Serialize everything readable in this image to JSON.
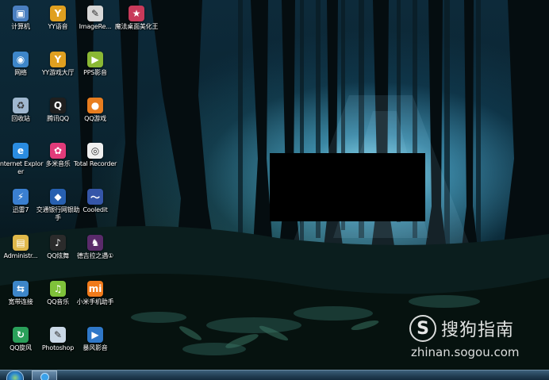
{
  "desktop": {
    "icons": [
      {
        "label": "计算机",
        "icon": "computer-icon",
        "color": "#4a7fc1",
        "glyph": "▣"
      },
      {
        "label": "YY语音",
        "icon": "yy-voice-icon",
        "color": "#e0a020",
        "glyph": "Y"
      },
      {
        "label": "ImageRe...",
        "icon": "image-app-icon",
        "color": "#d8d8d8",
        "glyph": "✎"
      },
      {
        "label": "魔法桌面美化王",
        "icon": "magic-desktop-icon",
        "color": "#c83a5a",
        "glyph": "★"
      },
      {
        "label": "网络",
        "icon": "network-icon",
        "color": "#3d86c9",
        "glyph": "◉"
      },
      {
        "label": "YY游戏大厅",
        "icon": "yy-game-icon",
        "color": "#e0a020",
        "glyph": "Y"
      },
      {
        "label": "PPS影音",
        "icon": "pps-icon",
        "color": "#8ab834",
        "glyph": "▶"
      },
      {
        "label": "回收站",
        "icon": "recycle-bin-icon",
        "color": "#9fb7cf",
        "glyph": "♻"
      },
      {
        "label": "腾讯QQ",
        "icon": "qq-icon",
        "color": "#1f1f1f",
        "glyph": "Q"
      },
      {
        "label": "QQ游戏",
        "icon": "qq-game-icon",
        "color": "#e87d1f",
        "glyph": "●"
      },
      {
        "label": "Internet Explorer",
        "icon": "ie-icon",
        "color": "#2a8ce0",
        "glyph": "e"
      },
      {
        "label": "多米音乐",
        "icon": "duomi-icon",
        "color": "#e23b7a",
        "glyph": "✿"
      },
      {
        "label": "Total Recorder",
        "icon": "recorder-icon",
        "color": "#f0f0f0",
        "glyph": "◎"
      },
      {
        "label": "迅雷7",
        "icon": "xunlei-icon",
        "color": "#3a7fd0",
        "glyph": "⚡"
      },
      {
        "label": "交通银行网银助手",
        "icon": "bank-icon",
        "color": "#2760b0",
        "glyph": "◆"
      },
      {
        "label": "Cooledit",
        "icon": "cooledit-icon",
        "color": "#3556a8",
        "glyph": "〜"
      },
      {
        "label": "Administr...",
        "icon": "folder-icon",
        "color": "#e0b84a",
        "glyph": "▤"
      },
      {
        "label": "QQ炫舞",
        "icon": "qq-dance-icon",
        "color": "#2b2b2b",
        "glyph": "♪"
      },
      {
        "label": "德吉拉之遇①",
        "icon": "game-icon",
        "color": "#5a2a6a",
        "glyph": "♞"
      },
      {
        "label": "宽带连接",
        "icon": "broadband-icon",
        "color": "#3d86c9",
        "glyph": "⇆"
      },
      {
        "label": "QQ音乐",
        "icon": "qq-music-icon",
        "color": "#7fc23a",
        "glyph": "♫"
      },
      {
        "label": "小米手机助手",
        "icon": "xiaomi-icon",
        "color": "#f07a1a",
        "glyph": "mi"
      },
      {
        "label": "QQ旋风",
        "icon": "qq-whirlwind-icon",
        "color": "#2aa05a",
        "glyph": "↻"
      },
      {
        "label": "Photoshop",
        "icon": "photoshop-icon",
        "color": "#c9d8e6",
        "glyph": "✎"
      },
      {
        "label": "暴风影音",
        "icon": "baofeng-icon",
        "color": "#2f78c8",
        "glyph": "▶"
      }
    ]
  },
  "watermark": {
    "logo_glyph": "S",
    "name": "搜狗指南",
    "url": "zhinan.sogou.com"
  },
  "taskbar": {
    "start_icon": "windows-start-icon",
    "pinned_icon": "ie-taskbar-icon"
  }
}
